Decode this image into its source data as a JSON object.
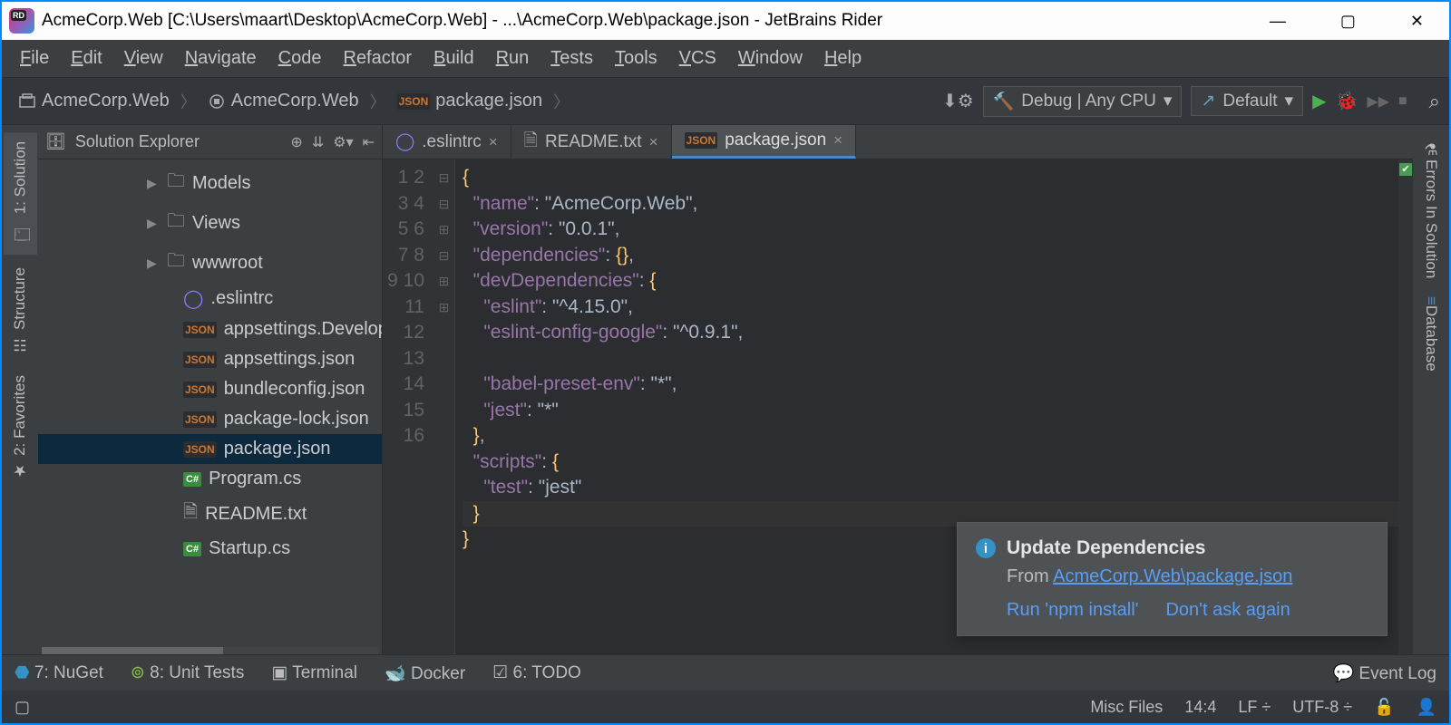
{
  "title": "AcmeCorp.Web [C:\\Users\\maart\\Desktop\\AcmeCorp.Web] - ...\\AcmeCorp.Web\\package.json - JetBrains Rider",
  "menu": [
    "File",
    "Edit",
    "View",
    "Navigate",
    "Code",
    "Refactor",
    "Build",
    "Run",
    "Tests",
    "Tools",
    "VCS",
    "Window",
    "Help"
  ],
  "breadcrumb": [
    "AcmeCorp.Web",
    "AcmeCorp.Web",
    "package.json"
  ],
  "run_config": "Debug | Any CPU",
  "deploy_config": "Default",
  "left_tabs": [
    "1: Solution",
    "Structure",
    "2: Favorites"
  ],
  "right_tabs": [
    "Errors In Solution",
    "Database"
  ],
  "explorer": {
    "title": "Solution Explorer",
    "items": [
      {
        "label": "Models",
        "type": "folder",
        "expand": true
      },
      {
        "label": "Views",
        "type": "folder",
        "expand": true
      },
      {
        "label": "wwwroot",
        "type": "folder",
        "expand": true
      },
      {
        "label": ".eslintrc",
        "type": "eslint"
      },
      {
        "label": "appsettings.Develop",
        "type": "json"
      },
      {
        "label": "appsettings.json",
        "type": "json"
      },
      {
        "label": "bundleconfig.json",
        "type": "json"
      },
      {
        "label": "package-lock.json",
        "type": "json"
      },
      {
        "label": "package.json",
        "type": "json",
        "selected": true
      },
      {
        "label": "Program.cs",
        "type": "cs"
      },
      {
        "label": "README.txt",
        "type": "txt"
      },
      {
        "label": "Startup.cs",
        "type": "cs"
      }
    ]
  },
  "tabs": [
    {
      "label": ".eslintrc",
      "icon": "eslint"
    },
    {
      "label": "README.txt",
      "icon": "txt"
    },
    {
      "label": "package.json",
      "icon": "json",
      "active": true
    }
  ],
  "code": {
    "lines": [
      "{",
      "  \"name\": \"AcmeCorp.Web\",",
      "  \"version\": \"0.0.1\",",
      "  \"dependencies\": {},",
      "  \"devDependencies\": {",
      "    \"eslint\": \"^4.15.0\",",
      "    \"eslint-config-google\": \"^0.9.1\",",
      "",
      "    \"babel-preset-env\": \"*\",",
      "    \"jest\": \"*\"",
      "  },",
      "  \"scripts\": {",
      "    \"test\": \"jest\"",
      "  }",
      "}",
      ""
    ],
    "line_count": 16
  },
  "notification": {
    "title": "Update Dependencies",
    "from_prefix": "From ",
    "from_link": "AcmeCorp.Web\\package.json",
    "action1": "Run 'npm install'",
    "action2": "Don't ask again"
  },
  "bottom_tools": [
    "7: NuGet",
    "8: Unit Tests",
    "Terminal",
    "Docker",
    "6: TODO"
  ],
  "event_log": "Event Log",
  "status": {
    "context": "Misc Files",
    "caret": "14:4",
    "line_sep": "LF",
    "encoding": "UTF-8"
  }
}
